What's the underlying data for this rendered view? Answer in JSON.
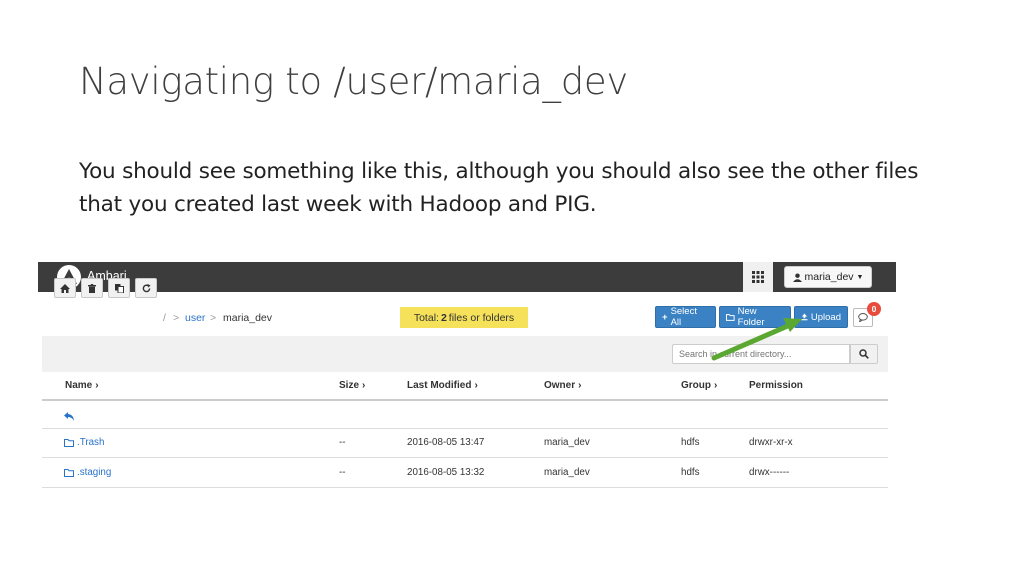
{
  "slide": {
    "title": "Navigating to /user/maria_dev",
    "body": "You should see something like this, although you should also see the other files that you created last week with Hadoop and PIG."
  },
  "app": {
    "brand": "Ambari",
    "user_label": "maria_dev",
    "grid_icon": "grid-icon",
    "accent_color": "#3a82c4",
    "topbar_color": "#3c3c3c"
  },
  "breadcrumb": {
    "root": "/",
    "sep1": ">",
    "user": "user",
    "sep2": ">",
    "current": "maria_dev"
  },
  "status": {
    "total_prefix": "Total:",
    "total_count": "2",
    "total_suffix": "files or folders",
    "badge_color": "#f5e15a"
  },
  "actions": {
    "select_all": "Select All",
    "new_folder": "New Folder",
    "upload": "Upload",
    "notification_count": "0"
  },
  "search": {
    "placeholder": "Search in current directory..."
  },
  "table": {
    "headers": {
      "name": "Name",
      "size": "Size",
      "last_modified": "Last Modified",
      "owner": "Owner",
      "group": "Group",
      "permission": "Permission"
    },
    "rows": [
      {
        "name": ".Trash",
        "size": "--",
        "last_modified": "2016-08-05 13:47",
        "owner": "maria_dev",
        "group": "hdfs",
        "permission": "drwxr-xr-x"
      },
      {
        "name": ".staging",
        "size": "--",
        "last_modified": "2016-08-05 13:32",
        "owner": "maria_dev",
        "group": "hdfs",
        "permission": "drwx------"
      }
    ]
  },
  "annotation": {
    "arrow_color": "#5aa832"
  }
}
